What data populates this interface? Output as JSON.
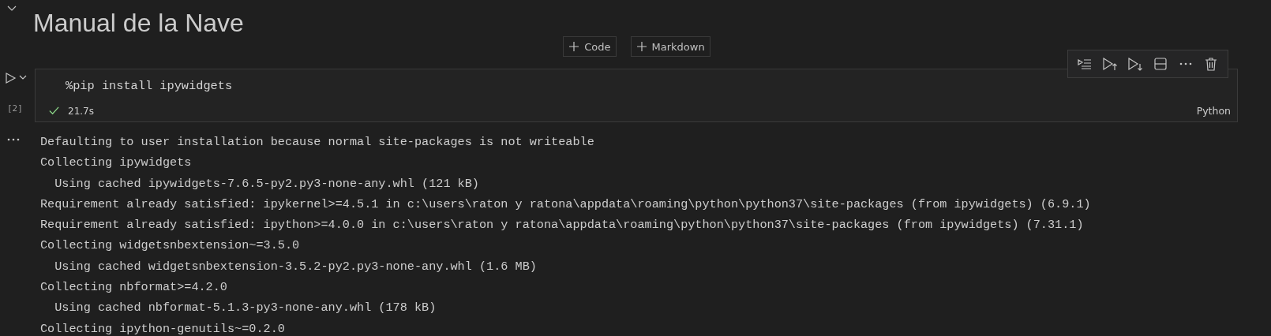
{
  "heading": {
    "text": "Manual de la Nave",
    "expanded": true
  },
  "add_buttons": [
    {
      "label": "Code"
    },
    {
      "label": "Markdown"
    }
  ],
  "cell": {
    "code": "%pip install ipywidgets",
    "execution_count": "[2]",
    "succeeded": true,
    "duration": "21.7s",
    "language": "Python"
  },
  "output_lines": [
    "Defaulting to user installation because normal site-packages is not writeable",
    "Collecting ipywidgets",
    "  Using cached ipywidgets-7.6.5-py2.py3-none-any.whl (121 kB)",
    "Requirement already satisfied: ipykernel>=4.5.1 in c:\\users\\raton y ratona\\appdata\\roaming\\python\\python37\\site-packages (from ipywidgets) (6.9.1)",
    "Requirement already satisfied: ipython>=4.0.0 in c:\\users\\raton y ratona\\appdata\\roaming\\python\\python37\\site-packages (from ipywidgets) (7.31.1)",
    "Collecting widgetsnbextension~=3.5.0",
    "  Using cached widgetsnbextension-3.5.2-py2.py3-none-any.whl (1.6 MB)",
    "Collecting nbformat>=4.2.0",
    "  Using cached nbformat-5.1.3-py3-none-any.whl (178 kB)",
    "Collecting ipython-genutils~=0.2.0"
  ]
}
